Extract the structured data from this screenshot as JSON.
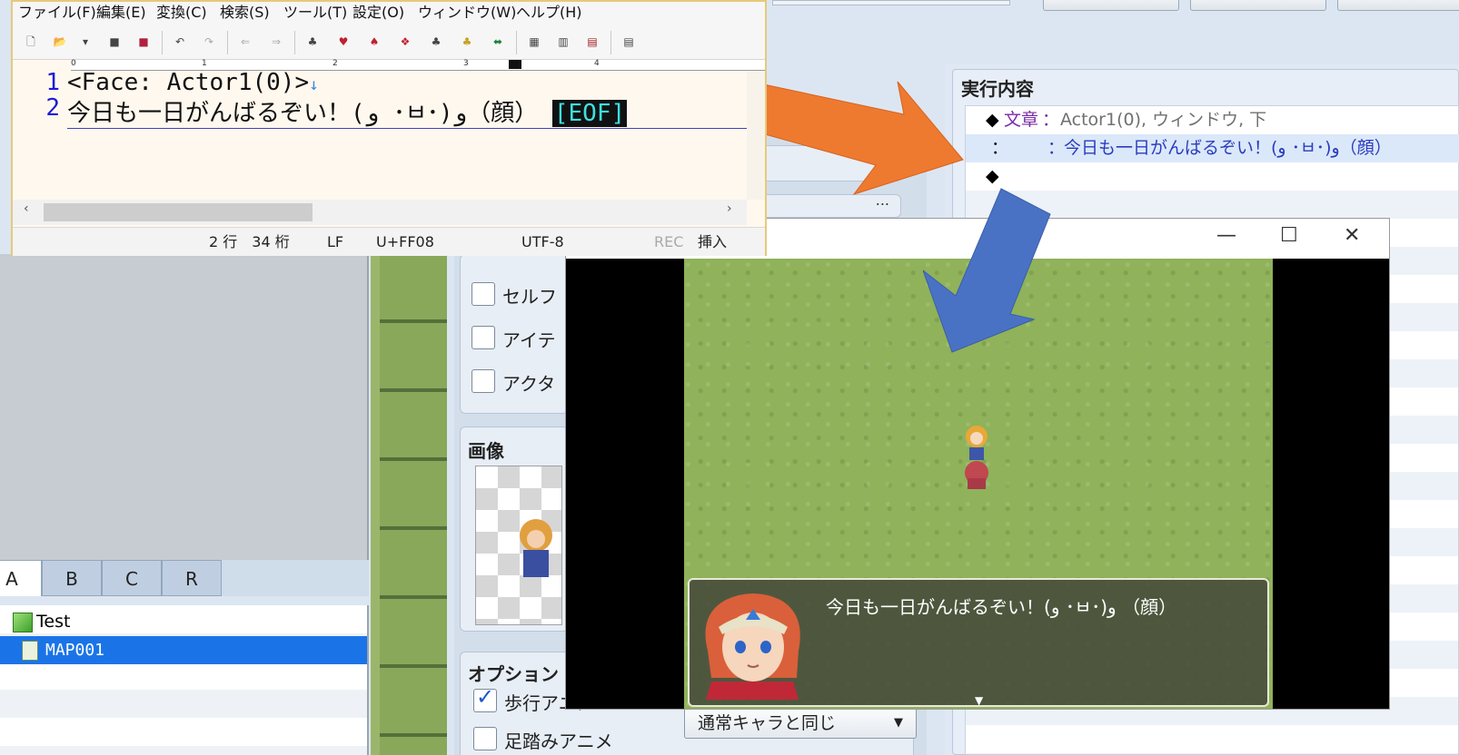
{
  "editor": {
    "menu": [
      "ファイル(F)",
      "編集(E)",
      "変換(C)",
      "検索(S)",
      "ツール(T)",
      "設定(O)",
      "ウィンドウ(W)",
      "ヘルプ(H)"
    ],
    "ruler": [
      "0",
      "1",
      "2",
      "3",
      "4"
    ],
    "lines": [
      {
        "num": "1",
        "text": "<Face: Actor1(0)>",
        "eol": "↓"
      },
      {
        "num": "2",
        "text": "今日も一日がんばるぞい！(و ･ㅂ･)و（顔）",
        "eof": "[EOF]"
      }
    ],
    "status": {
      "pos": "2 行　34 桁",
      "eol": "LF",
      "code": "U+FF08",
      "enc": "UTF-8",
      "rec": "REC",
      "mode": "挿入"
    }
  },
  "rpgmaker": {
    "exec_title": "実行内容",
    "exec_rows": [
      {
        "marker": "◆",
        "cmd": "文章",
        "sep": "：",
        "args": "Actor1(0), ウィンドウ, 下"
      },
      {
        "marker": "：",
        "cmd": "",
        "sep": "：",
        "args": "今日も一日がんばるぞい！(و ･ㅂ･)و（顔）"
      },
      {
        "marker": "◆",
        "cmd": "",
        "sep": "",
        "args": ""
      }
    ],
    "tabs": [
      "A",
      "B",
      "C",
      "R"
    ],
    "tree": [
      {
        "label": "Test",
        "icon": "project-cube-icon"
      },
      {
        "label": "MAP001",
        "icon": "map-icon"
      }
    ],
    "checkboxes": [
      {
        "label": "セルフ",
        "checked": false
      },
      {
        "label": "アイテ",
        "checked": false
      },
      {
        "label": "アクタ",
        "checked": false
      }
    ],
    "image_label": "画像",
    "options_label": "オプション",
    "option_checks": [
      {
        "label": "歩行アニメ",
        "checked": true
      },
      {
        "label": "足踏みアニメ",
        "checked": false
      }
    ],
    "priority_select": "通常キャラと同じ",
    "ellipsis": "..."
  },
  "game": {
    "message": "今日も一日がんばるぞい！(و ･ㅂ･)و （顔）",
    "buttons": {
      "minimize": "—",
      "maximize": "☐",
      "close": "✕"
    }
  },
  "colors": {
    "orange_arrow": "#ee7a30",
    "blue_arrow": "#4a72c4",
    "selection": "#1a74e8"
  }
}
